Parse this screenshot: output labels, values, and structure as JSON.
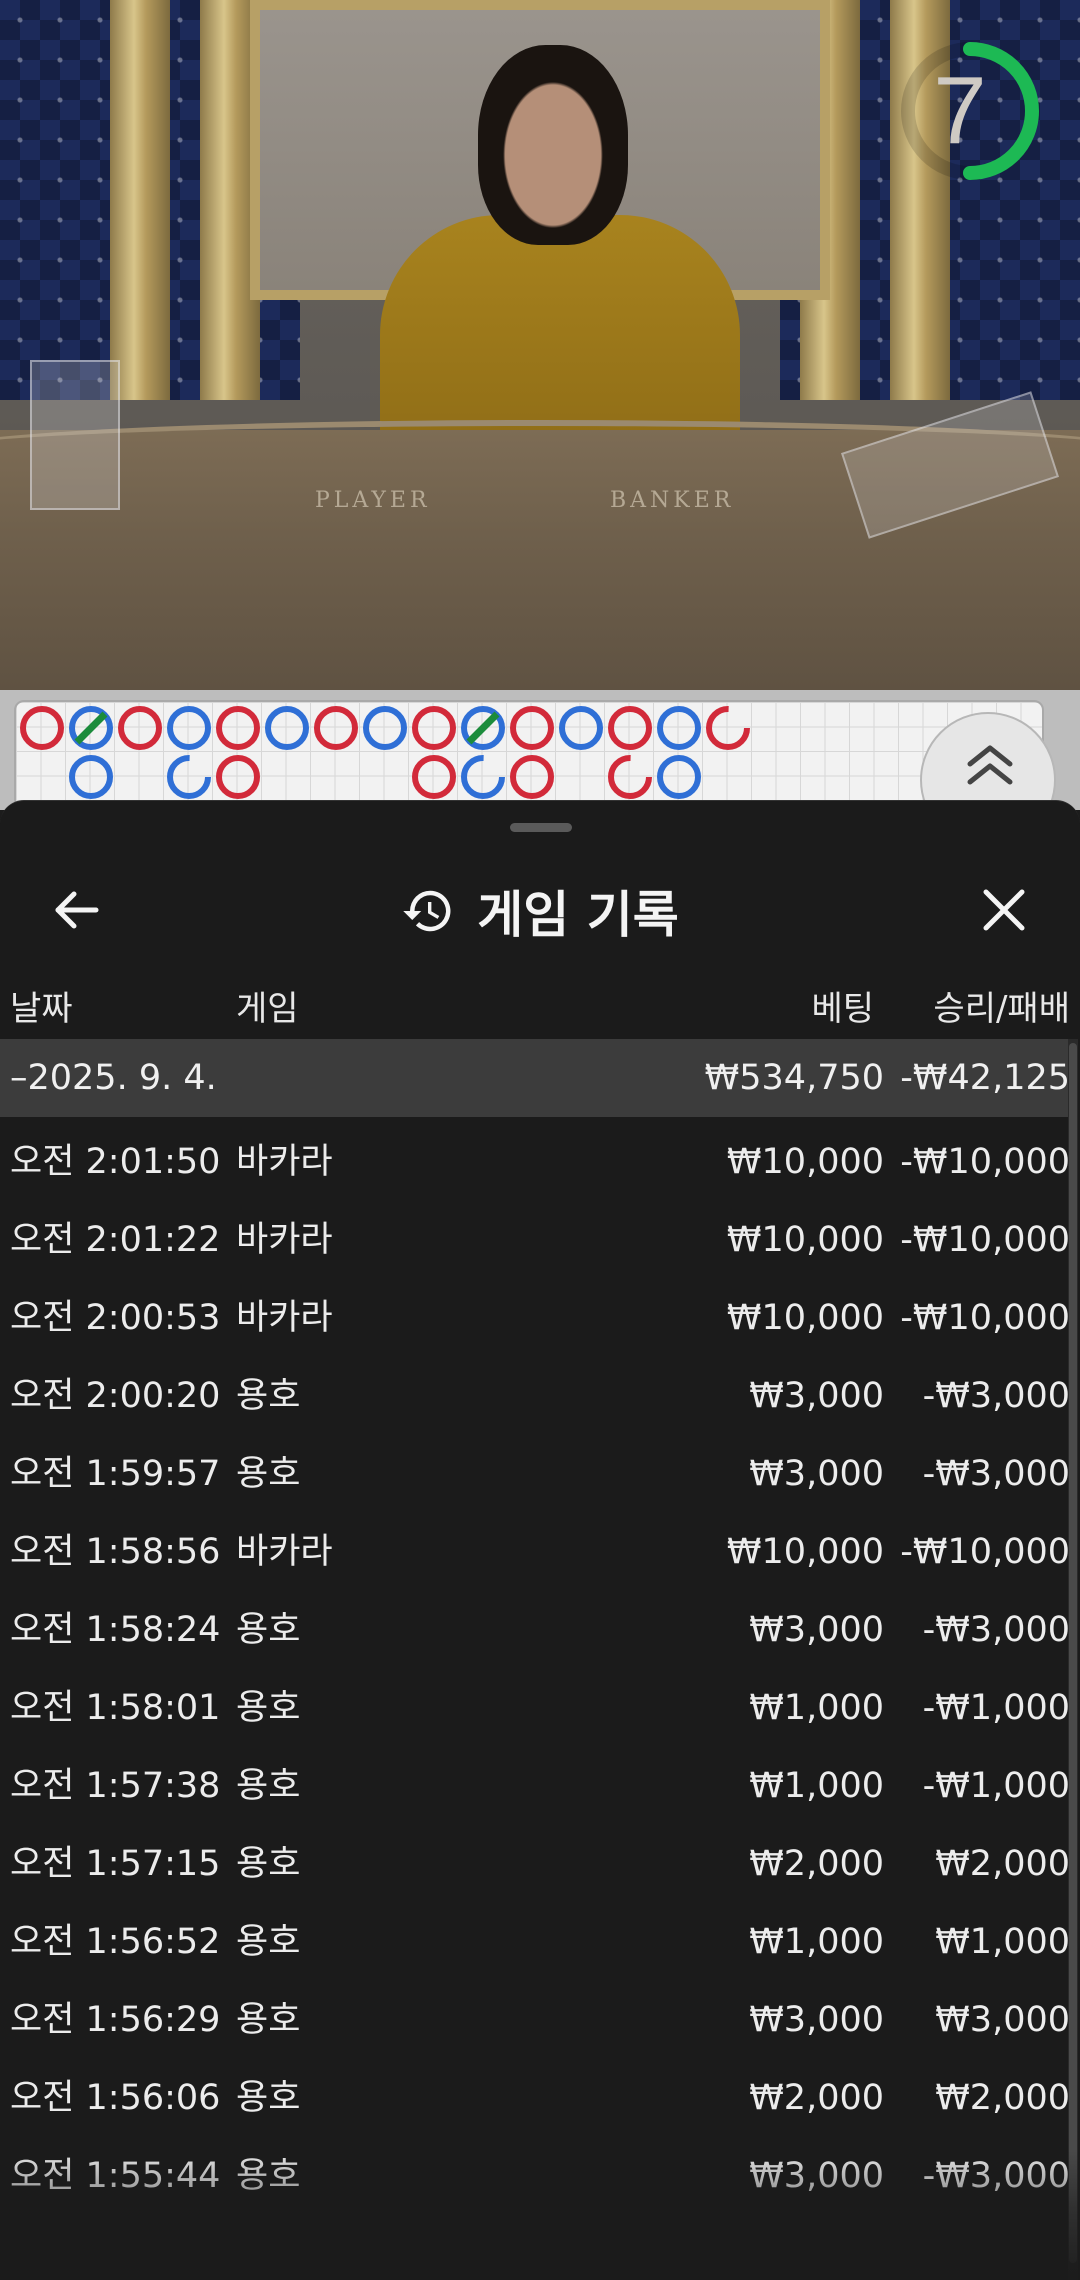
{
  "video": {
    "table_labels": {
      "player": "PLAYER",
      "banker": "BANKER"
    },
    "countdown": "7",
    "countdown_color": "#1db954"
  },
  "roadmap": {
    "colors": {
      "player": "#2f6fd6",
      "banker": "#d22a3a",
      "tie": "#1c8c3c"
    },
    "top_row": [
      "banker",
      "player-tie",
      "banker",
      "player",
      "banker",
      "player",
      "banker",
      "player",
      "banker",
      "player-tie",
      "banker",
      "player",
      "banker",
      "player",
      "banker-partial"
    ],
    "bottom_row": [
      "",
      "player",
      "",
      "player-partial",
      "banker",
      "",
      "",
      "",
      "banker",
      "player-partial",
      "banker",
      "",
      "banker-partial",
      "player",
      ""
    ],
    "expand_icon": "double-chevron-up-icon"
  },
  "sheet": {
    "title": "게임 기록",
    "title_icon": "history-icon",
    "back_icon": "arrow-left-icon",
    "close_icon": "close-icon"
  },
  "columns": {
    "date": "날짜",
    "game": "게임",
    "bet": "베팅",
    "result": "승리/패배"
  },
  "day_group": {
    "date": "–2025. 9. 4.",
    "bet_total": "₩534,750",
    "result_total": "-₩42,125"
  },
  "records": [
    {
      "time": "오전 2:01:50",
      "game": "바카라",
      "bet": "₩10,000",
      "result": "-₩10,000"
    },
    {
      "time": "오전 2:01:22",
      "game": "바카라",
      "bet": "₩10,000",
      "result": "-₩10,000"
    },
    {
      "time": "오전 2:00:53",
      "game": "바카라",
      "bet": "₩10,000",
      "result": "-₩10,000"
    },
    {
      "time": "오전 2:00:20",
      "game": "용호",
      "bet": "₩3,000",
      "result": "-₩3,000"
    },
    {
      "time": "오전 1:59:57",
      "game": "용호",
      "bet": "₩3,000",
      "result": "-₩3,000"
    },
    {
      "time": "오전 1:58:56",
      "game": "바카라",
      "bet": "₩10,000",
      "result": "-₩10,000"
    },
    {
      "time": "오전 1:58:24",
      "game": "용호",
      "bet": "₩3,000",
      "result": "-₩3,000"
    },
    {
      "time": "오전 1:58:01",
      "game": "용호",
      "bet": "₩1,000",
      "result": "-₩1,000"
    },
    {
      "time": "오전 1:57:38",
      "game": "용호",
      "bet": "₩1,000",
      "result": "-₩1,000"
    },
    {
      "time": "오전 1:57:15",
      "game": "용호",
      "bet": "₩2,000",
      "result": "₩2,000"
    },
    {
      "time": "오전 1:56:52",
      "game": "용호",
      "bet": "₩1,000",
      "result": "₩1,000"
    },
    {
      "time": "오전 1:56:29",
      "game": "용호",
      "bet": "₩3,000",
      "result": "₩3,000"
    },
    {
      "time": "오전 1:56:06",
      "game": "용호",
      "bet": "₩2,000",
      "result": "₩2,000"
    },
    {
      "time": "오전 1:55:44",
      "game": "용호",
      "bet": "₩3,000",
      "result": "-₩3,000"
    }
  ]
}
